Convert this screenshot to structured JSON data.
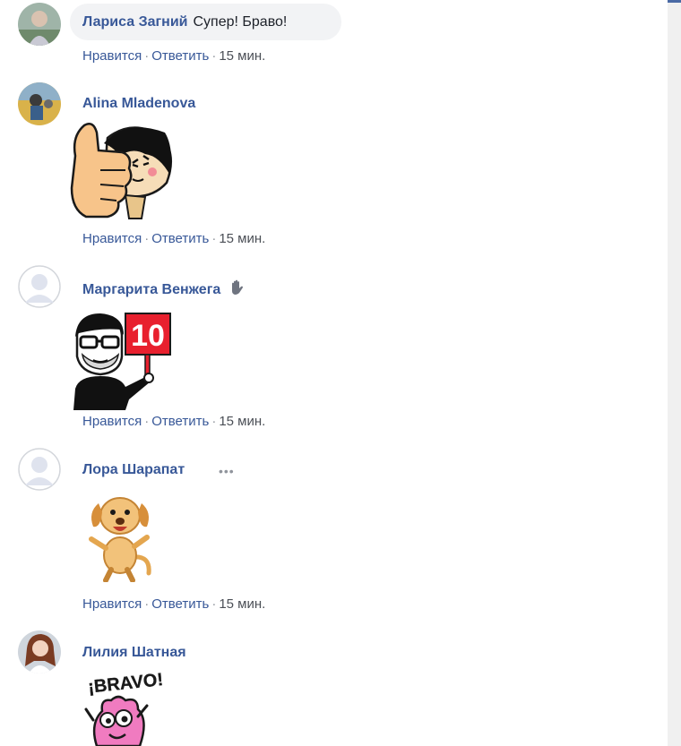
{
  "comments": [
    {
      "author": "Лариса Загний",
      "text": "Супер! Браво!",
      "actions": {
        "like": "Нравится",
        "reply": "Ответить",
        "time": "15 мин."
      }
    },
    {
      "author": "Alina Mladenova",
      "sticker": "thumbs-up-girl",
      "actions": {
        "like": "Нравится",
        "reply": "Ответить",
        "time": "15 мин."
      }
    },
    {
      "author": "Маргарита Венжега",
      "author_icon": "waving-hand-icon",
      "sticker": "score-10-sign",
      "sticker_text": "10",
      "actions": {
        "like": "Нравится",
        "reply": "Ответить",
        "time": "15 мин."
      }
    },
    {
      "author": "Лора Шарапат",
      "menu_icon": "more-options-icon",
      "sticker": "dancing-dog",
      "actions": {
        "like": "Нравится",
        "reply": "Ответить",
        "time": "15 мин."
      }
    },
    {
      "author": "Лилия Шатная",
      "sticker": "bravo-pink-monster",
      "sticker_text": "¡BRAVO!"
    }
  ],
  "colors": {
    "link": "#385898",
    "text": "#1d2129",
    "meta": "#4b4f56",
    "bubble": "#f2f3f5"
  }
}
